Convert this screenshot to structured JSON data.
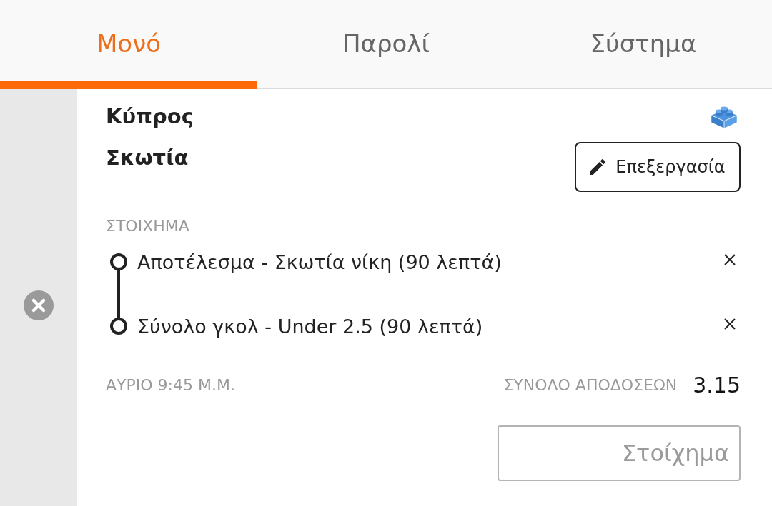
{
  "tabs": [
    {
      "label": "Μονό",
      "selected": true
    },
    {
      "label": "Παρολί",
      "selected": false
    },
    {
      "label": "Σύστημα",
      "selected": false
    }
  ],
  "bet": {
    "teams": [
      "Κύπρος",
      "Σκωτία"
    ],
    "edit_button": "Επεξεργασία",
    "section_label": "ΣΤΟΙΧΗΜΑ",
    "selections": [
      {
        "text": "Αποτέλεσμα - Σκωτία νίκη (90 λεπτά)"
      },
      {
        "text": "Σύνολο γκολ - Under 2.5 (90 λεπτά)"
      }
    ],
    "kickoff": "ΑΥΡΙΟ 9:45 Μ.Μ.",
    "total_odds_label": "ΣΥΝΟΛΟ ΑΠΟΔΟΣΕΩΝ",
    "total_odds": "3.15",
    "stake": {
      "placeholder": "Στοίχημα"
    }
  }
}
